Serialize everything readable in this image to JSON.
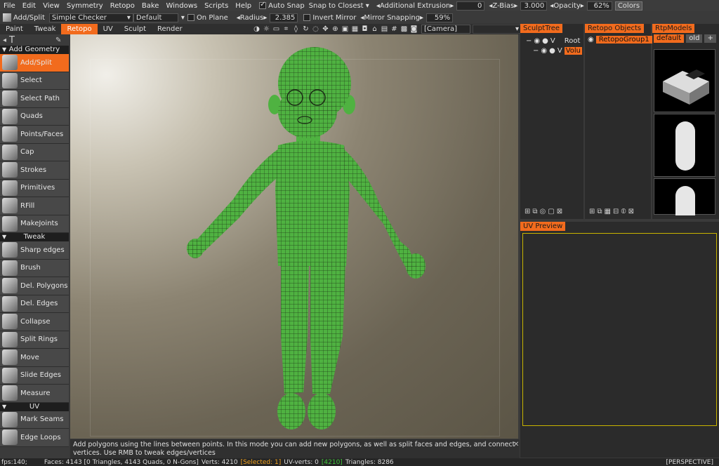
{
  "menu": [
    "File",
    "Edit",
    "View",
    "Symmetry",
    "Retopo",
    "Bake",
    "Windows",
    "Scripts",
    "Help"
  ],
  "options_bar": {
    "auto_snap_label": "Auto Snap",
    "snap_mode": "Snap to Closest",
    "additional_extrusion_label": "Additional Extrusion",
    "additional_extrusion_value": "0",
    "zbias_label": "Z-Bias",
    "zbias_value": "3.000",
    "opacity_label": "Opacity",
    "opacity_value": "62%",
    "colors_button": "Colors"
  },
  "toolbar2": {
    "tool_label": "Add/Split",
    "material": "Simple Checker",
    "preset": "Default",
    "on_plane_label": "On Plane",
    "radius_label": "Radius",
    "radius_value": "2.385",
    "invert_mirror_label": "Invert Mirror",
    "mirror_snapping_label": "Mirror Snapping",
    "mirror_snapping_value": "59%"
  },
  "room_tabs": [
    "Paint",
    "Tweak",
    "Retopo",
    "UV",
    "Sculpt",
    "Render"
  ],
  "active_room": "Retopo",
  "camera_select": "[Camera]",
  "tools": {
    "add_geometry_header": "Add Geometry",
    "add_geometry": [
      "Add/Split",
      "Select",
      "Select Path",
      "Quads",
      "Points/Faces",
      "Cap",
      "Strokes",
      "Primitives",
      "RFill",
      "MakeJoints"
    ],
    "tweak_header": "Tweak",
    "tweak": [
      "Sharp edges",
      "Brush",
      "Del. Polygons",
      "Del. Edges",
      "Collapse",
      "Split Rings",
      "Move",
      "Slide Edges",
      "Measure"
    ],
    "uv_header": "UV",
    "uv": [
      "Mark Seams",
      "Edge Loops"
    ]
  },
  "sculpt_tree": {
    "title": "SculptTree",
    "root": "Root",
    "volume": "Volu"
  },
  "retopo_objects": {
    "title": "Retopo Objects",
    "group": "RetopoGroup1"
  },
  "rtp_models": {
    "title": "RtpModels",
    "tabs": [
      "default",
      "old",
      "+"
    ]
  },
  "uv_preview": {
    "title": "UV Preview"
  },
  "hint_text": "Add polygons using the lines between points. In this mode you can add new polygons, as well as split faces and edges, and connect vertices. Use RMB to tweak edges/vertices",
  "status": {
    "fps": "fps:140;",
    "faces": "Faces: 4143 [0 Triangles, 4143 Quads, 0 N-Gons]",
    "verts": "Verts: 4210",
    "selected": "Selected: 1",
    "uv_verts": "UV-verts: 0",
    "uv_count": "4210",
    "triangles": "Triangles: 8286",
    "view": "[PERSPECTIVE]"
  },
  "colors": {
    "accent": "#f26b1d",
    "mesh": "#3fa83a"
  }
}
